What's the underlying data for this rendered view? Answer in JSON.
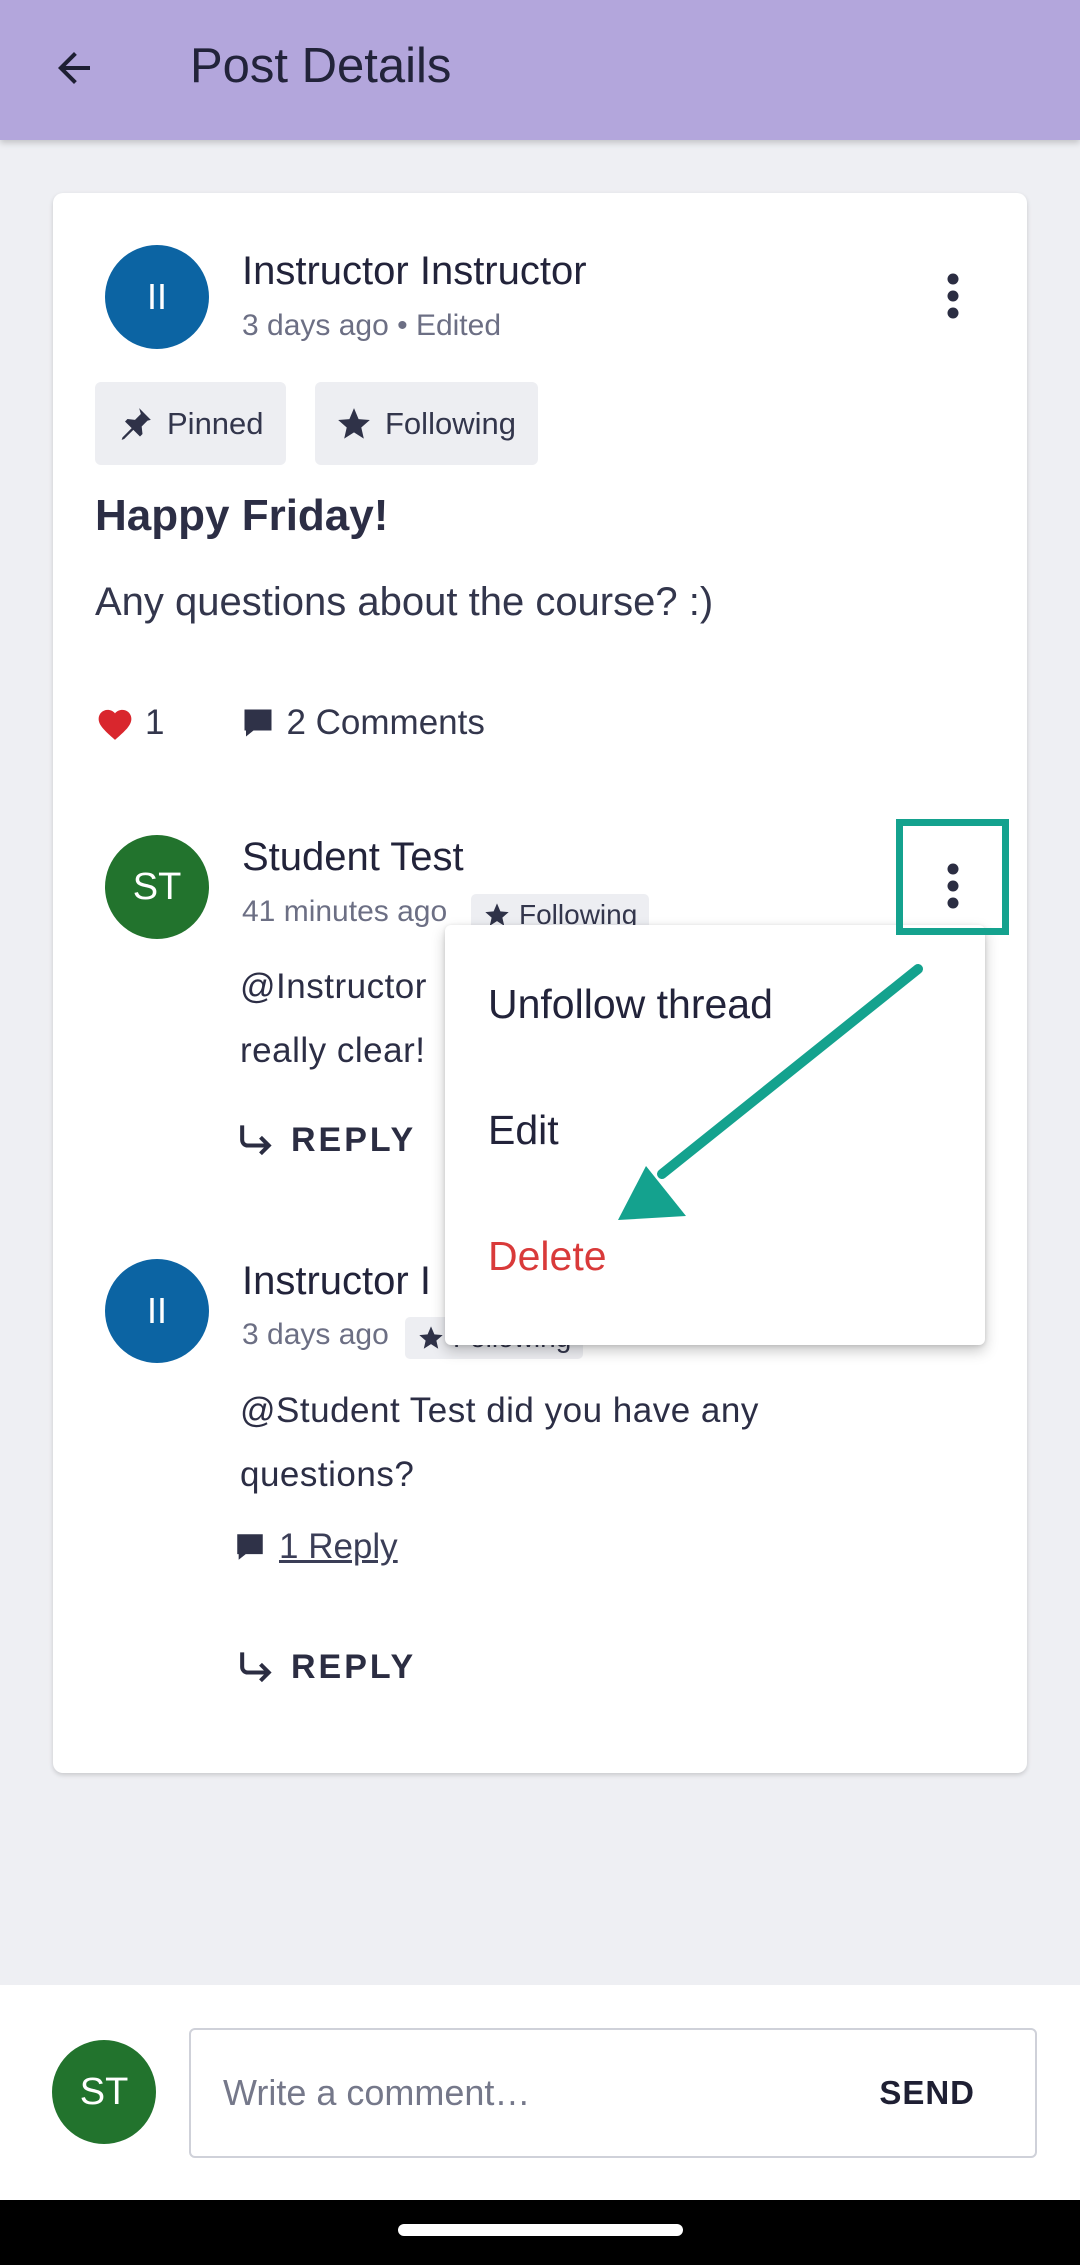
{
  "header": {
    "title": "Post Details",
    "back_icon": "arrow-left-icon"
  },
  "post": {
    "author": {
      "initials": "II",
      "name": "Instructor Instructor",
      "avatar_color": "#0c64a3"
    },
    "meta": "3 days ago • Edited",
    "chips": [
      {
        "label": "Pinned",
        "icon": "pin-icon"
      },
      {
        "label": "Following",
        "icon": "star-icon"
      }
    ],
    "title": "Happy Friday!",
    "body": "Any questions about the course? :)",
    "likes": "1",
    "comments_label": "2 Comments"
  },
  "comments": [
    {
      "initials": "ST",
      "name": "Student Test",
      "avatar_color": "#22732d",
      "time": "41 minutes ago",
      "chip": "Following",
      "line1": "@Instructor",
      "line2": "really clear!",
      "reply_label": "REPLY"
    },
    {
      "initials": "II",
      "name": "Instructor I",
      "avatar_color": "#0c64a3",
      "time": "3 days ago",
      "chip": "Following",
      "line1": "@Student Test did you have any",
      "line2": "questions?",
      "replies_link": "1 Reply",
      "reply_label": "REPLY"
    }
  ],
  "menu": {
    "items": [
      {
        "label": "Unfollow thread"
      },
      {
        "label": "Edit"
      },
      {
        "label": "Delete",
        "color": "#d93a3a"
      }
    ]
  },
  "composer": {
    "initials": "ST",
    "placeholder": "Write a comment…",
    "send_label": "SEND"
  },
  "colors": {
    "app_bar": "#b3a6dc",
    "highlight": "#14a28e",
    "danger": "#d93a3a",
    "heart": "#d9262d"
  }
}
